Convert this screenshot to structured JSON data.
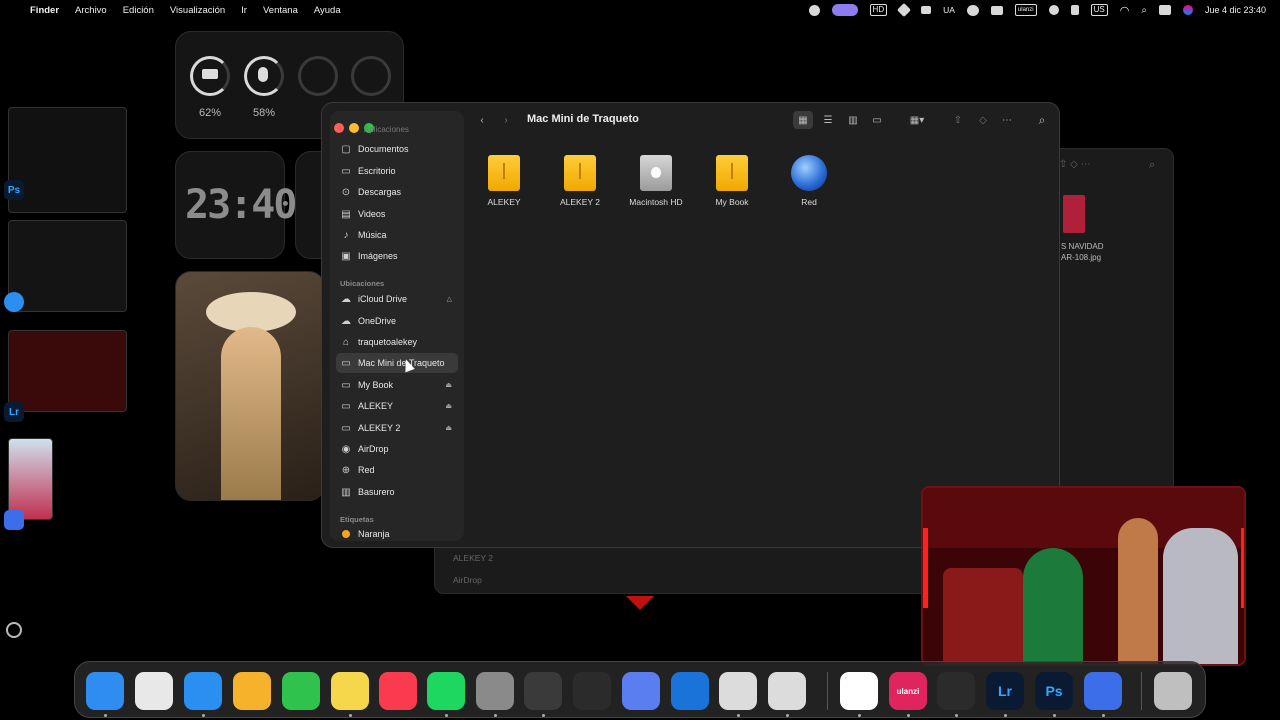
{
  "menubar": {
    "app": "Finder",
    "menus": [
      "Archivo",
      "Edición",
      "Visualización",
      "Ir",
      "Ventana",
      "Ayuda"
    ],
    "status": {
      "lang": "UA",
      "brand": "ulanzi",
      "input": "US",
      "datetime": "Jue 4 dic  23:40"
    }
  },
  "widgets": {
    "keyboard_battery": "62%",
    "mouse_battery": "58%",
    "clock": "23:40"
  },
  "finder": {
    "title": "Mac Mini de Traqueto",
    "sidebar": {
      "clipped_item": "Aplicaciones",
      "favorites": [
        {
          "label": "Documentos",
          "icon": "document-icon"
        },
        {
          "label": "Escritorio",
          "icon": "desktop-icon"
        },
        {
          "label": "Descargas",
          "icon": "download-icon"
        },
        {
          "label": "Videos",
          "icon": "video-icon"
        },
        {
          "label": "Música",
          "icon": "music-icon"
        },
        {
          "label": "Imágenes",
          "icon": "photo-icon"
        }
      ],
      "locations_header": "Ubicaciones",
      "locations": [
        {
          "label": "iCloud Drive",
          "icon": "cloud-icon",
          "badge": "warning"
        },
        {
          "label": "OneDrive",
          "icon": "cloud-icon"
        },
        {
          "label": "traquetoalekey",
          "icon": "home-icon"
        },
        {
          "label": "Mac Mini de Traqueto",
          "icon": "computer-icon",
          "selected": true
        },
        {
          "label": "My Book",
          "icon": "drive-icon",
          "eject": true
        },
        {
          "label": "ALEKEY",
          "icon": "drive-icon",
          "eject": true
        },
        {
          "label": "ALEKEY 2",
          "icon": "drive-icon",
          "eject": true
        },
        {
          "label": "AirDrop",
          "icon": "airdrop-icon"
        },
        {
          "label": "Red",
          "icon": "network-icon"
        },
        {
          "label": "Basurero",
          "icon": "trash-icon"
        }
      ],
      "tags_header": "Etiquetas",
      "tags": [
        {
          "label": "Naranja",
          "color": "#f5a623"
        }
      ]
    },
    "items": [
      {
        "label": "ALEKEY",
        "type": "yellow-drive"
      },
      {
        "label": "ALEKEY 2",
        "type": "yellow-drive"
      },
      {
        "label": "Macintosh HD",
        "type": "grey-drive"
      },
      {
        "label": "My Book",
        "type": "yellow-drive"
      },
      {
        "label": "Red",
        "type": "globe"
      }
    ]
  },
  "back_window": {
    "file_label_line1": "S NAVIDAD",
    "file_label_line2": "AR-108.jpg",
    "sidebar_items": [
      "ALEKEY 2",
      "AirDrop"
    ]
  },
  "stage_badges": [
    "Ps",
    "Lr"
  ],
  "dock": {
    "apps": [
      {
        "name": "finder",
        "color": "#2f8cf0"
      },
      {
        "name": "launchpad",
        "color": "#e8e8e8"
      },
      {
        "name": "safari",
        "color": "#2a8ff0"
      },
      {
        "name": "home",
        "color": "#f7b22c"
      },
      {
        "name": "facetime",
        "color": "#2fc24d"
      },
      {
        "name": "notes",
        "color": "#f6d64a"
      },
      {
        "name": "music",
        "color": "#fa3b4f"
      },
      {
        "name": "spotify",
        "color": "#1ed760"
      },
      {
        "name": "settings",
        "color": "#8a8a8a"
      },
      {
        "name": "fl-studio",
        "color": "#3a3a3a"
      },
      {
        "name": "davinci-resolve",
        "color": "#2b2b2b"
      },
      {
        "name": "phone-mirroring",
        "color": "#5a7ef0"
      },
      {
        "name": "outlook",
        "color": "#1a73d8"
      },
      {
        "name": "audio-app-1",
        "color": "#dcdcdc"
      },
      {
        "name": "audio-app-2",
        "color": "#dcdcdc"
      },
      {
        "name": "chrome",
        "color": "#ffffff"
      },
      {
        "name": "ulanzi-studio",
        "color": "#e0245e",
        "label": "ulanzi"
      },
      {
        "name": "obs",
        "color": "#2b2b2b"
      },
      {
        "name": "lightroom",
        "color": "#0a1a33",
        "label": "Lr"
      },
      {
        "name": "photoshop",
        "color": "#0a1a33",
        "label": "Ps"
      },
      {
        "name": "screenshot-app",
        "color": "#3b6ee8"
      },
      {
        "name": "trash",
        "color": "#bfbfbf"
      }
    ]
  }
}
